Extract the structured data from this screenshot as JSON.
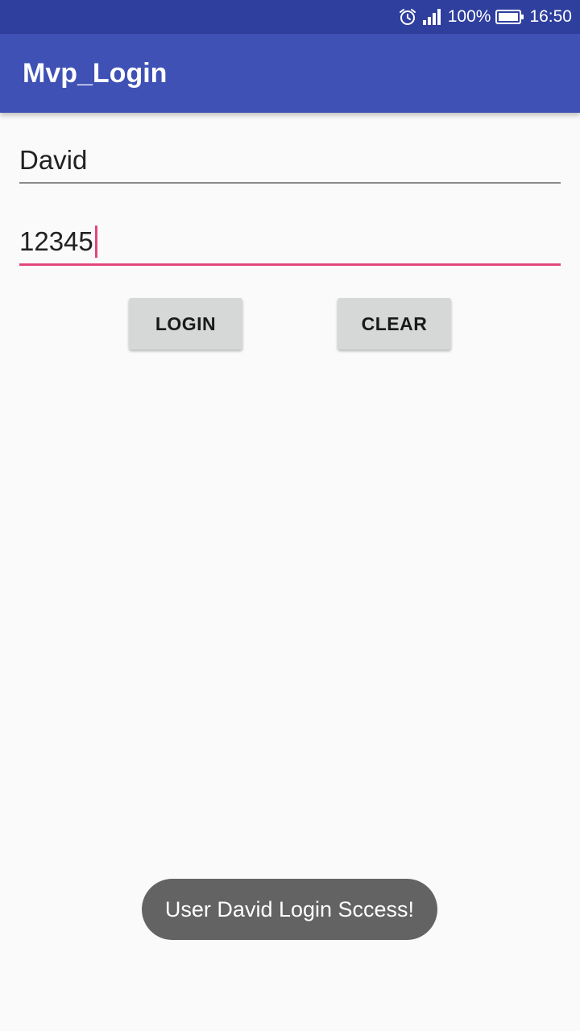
{
  "status_bar": {
    "battery_percent": "100%",
    "time": "16:50",
    "icons": [
      "alarm-icon",
      "signal-icon",
      "battery-icon"
    ]
  },
  "app_bar": {
    "title": "Mvp_Login"
  },
  "form": {
    "username_value": "David",
    "password_value": "12345",
    "login_label": "LOGIN",
    "clear_label": "CLEAR"
  },
  "toast": {
    "message": "User David Login Sccess!"
  },
  "colors": {
    "status_bar": "#2f3f9e",
    "app_bar": "#3f51b5",
    "accent": "#e2457d",
    "background": "#fafafa",
    "button": "#d6d7d7",
    "toast": "#636363"
  }
}
